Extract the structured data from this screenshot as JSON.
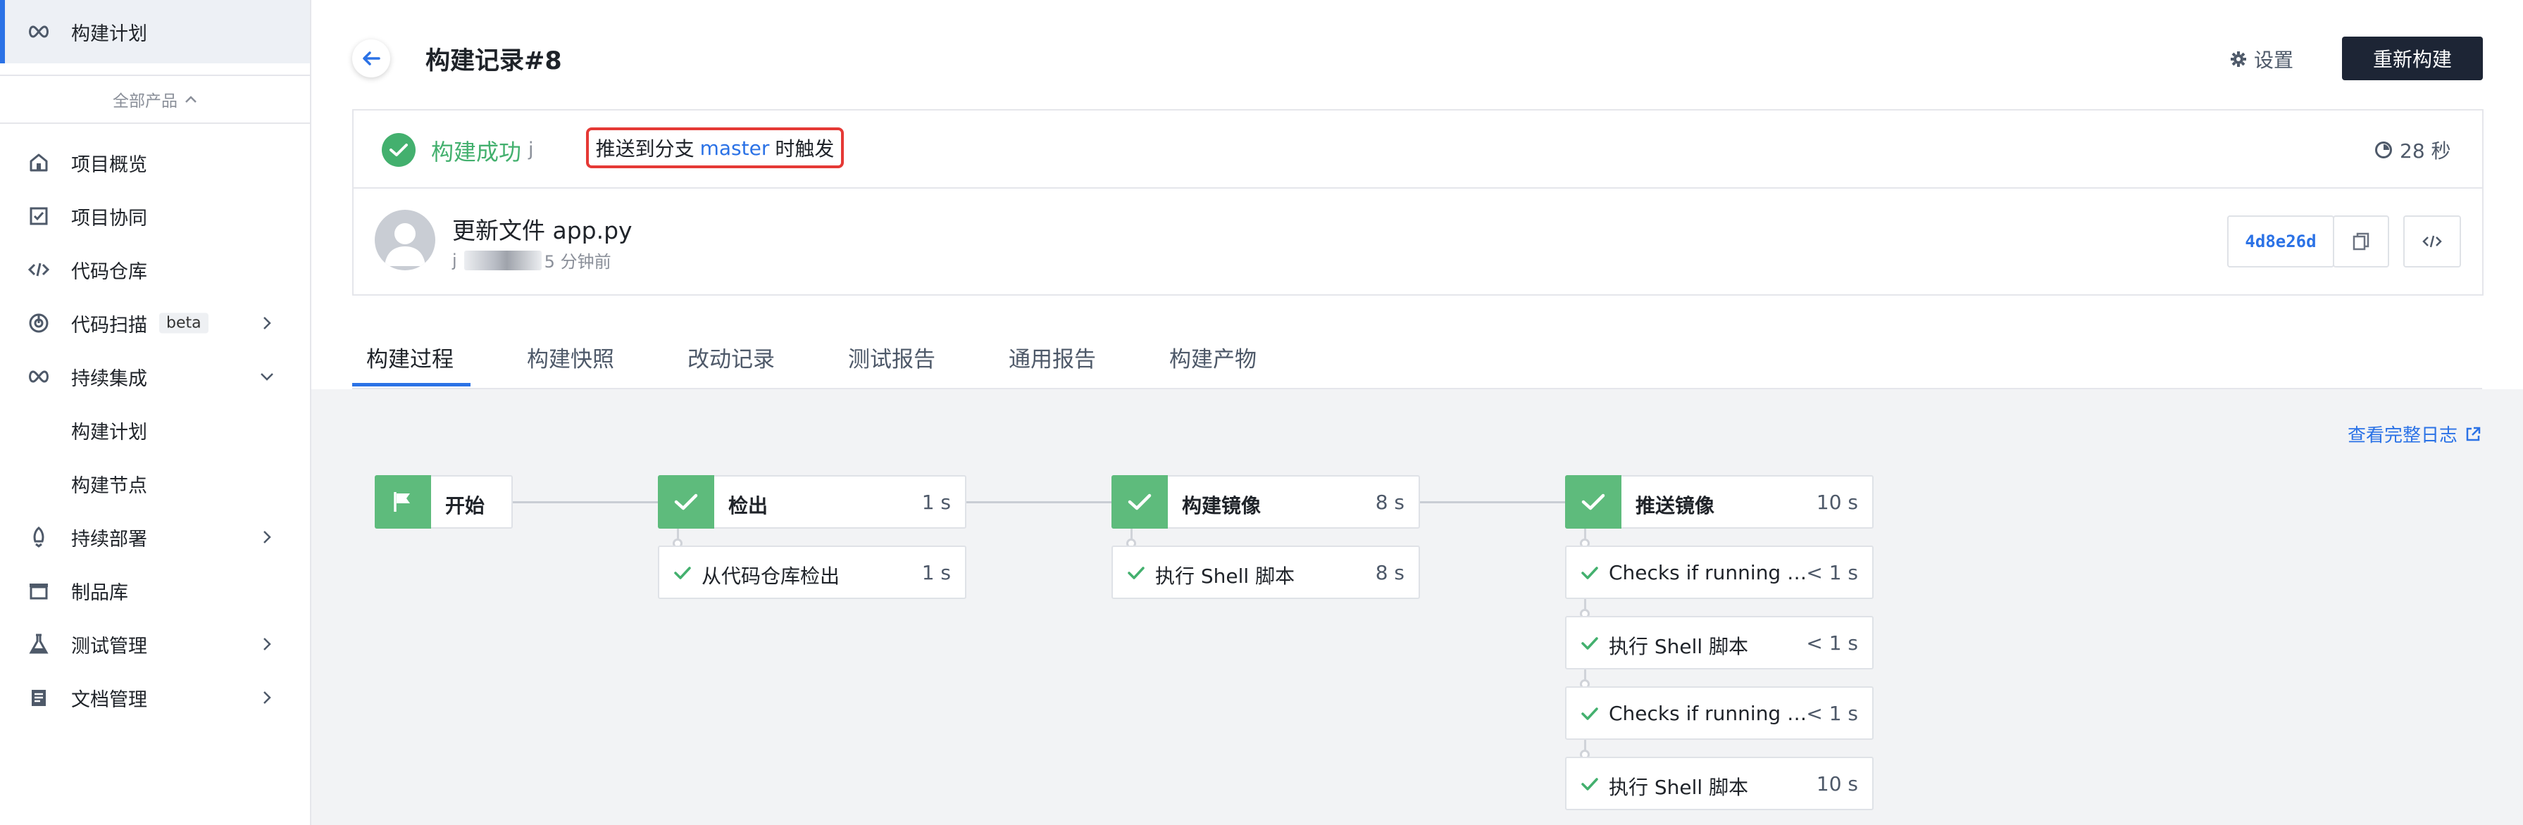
{
  "sidebar": {
    "active_item": "构建计划",
    "all_products": "全部产品",
    "items": [
      {
        "label": "项目概览",
        "icon": "home-icon"
      },
      {
        "label": "项目协同",
        "icon": "checkbox-icon"
      },
      {
        "label": "代码仓库",
        "icon": "code-icon"
      },
      {
        "label": "代码扫描",
        "icon": "scan-icon",
        "badge": "beta"
      },
      {
        "label": "持续集成",
        "icon": "infinity-icon"
      },
      {
        "label": "构建计划"
      },
      {
        "label": "构建节点"
      },
      {
        "label": "持续部署",
        "icon": "rocket-icon"
      },
      {
        "label": "制品库",
        "icon": "package-icon"
      },
      {
        "label": "测试管理",
        "icon": "flask-icon"
      },
      {
        "label": "文档管理",
        "icon": "doc-icon"
      }
    ]
  },
  "header": {
    "title": "构建记录#8",
    "settings_label": "设置",
    "rebuild_label": "重新构建"
  },
  "build": {
    "status": "构建成功",
    "user_initial": "j",
    "trigger_prefix": "推送到分支",
    "branch": "master",
    "trigger_suffix": "时触发",
    "duration": "28 秒",
    "commit_message": "更新文件 app.py",
    "commit_author_initial": "j",
    "commit_time": "5 分钟前",
    "commit_sha": "4d8e26d"
  },
  "tabs": [
    "构建过程",
    "构建快照",
    "改动记录",
    "测试报告",
    "通用报告",
    "构建产物"
  ],
  "full_log_label": "查看完整日志",
  "pipeline": {
    "start_label": "开始",
    "stages": [
      {
        "name": "检出",
        "time": "1 s",
        "jobs": [
          {
            "name": "从代码仓库检出",
            "time": "1 s"
          }
        ]
      },
      {
        "name": "构建镜像",
        "time": "8 s",
        "jobs": [
          {
            "name": "执行 Shell 脚本",
            "time": "8 s"
          }
        ]
      },
      {
        "name": "推送镜像",
        "time": "10 s",
        "jobs": [
          {
            "name": "Checks if running o...",
            "time": "< 1 s"
          },
          {
            "name": "执行 Shell 脚本",
            "time": "< 1 s"
          },
          {
            "name": "Checks if running o...",
            "time": "< 1 s"
          },
          {
            "name": "执行 Shell 脚本",
            "time": "10 s"
          }
        ]
      }
    ]
  },
  "colors": {
    "accent": "#2b72e6",
    "success": "#43b06e",
    "stage_icon": "#5ebb7c",
    "primary_button": "#1d2535",
    "highlight_border": "#e53935"
  }
}
